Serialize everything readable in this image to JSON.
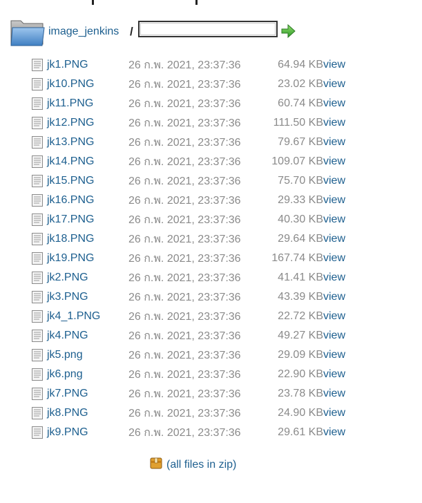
{
  "breadcrumb": {
    "directory_link": "image_jenkins",
    "separator": "/",
    "path_input_value": "",
    "go_button_icon": "go-arrow-icon"
  },
  "colors": {
    "link": "#1d5f8f",
    "muted": "#8a8a8a"
  },
  "files": [
    {
      "name": "jk1.PNG",
      "date": "26 ก.พ. 2021, 23:37:36",
      "size": "64.94 KB",
      "view": "view"
    },
    {
      "name": "jk10.PNG",
      "date": "26 ก.พ. 2021, 23:37:36",
      "size": "23.02 KB",
      "view": "view"
    },
    {
      "name": "jk11.PNG",
      "date": "26 ก.พ. 2021, 23:37:36",
      "size": "60.74 KB",
      "view": "view"
    },
    {
      "name": "jk12.PNG",
      "date": "26 ก.พ. 2021, 23:37:36",
      "size": "111.50 KB",
      "view": "view"
    },
    {
      "name": "jk13.PNG",
      "date": "26 ก.พ. 2021, 23:37:36",
      "size": "79.67 KB",
      "view": "view"
    },
    {
      "name": "jk14.PNG",
      "date": "26 ก.พ. 2021, 23:37:36",
      "size": "109.07 KB",
      "view": "view"
    },
    {
      "name": "jk15.PNG",
      "date": "26 ก.พ. 2021, 23:37:36",
      "size": "75.70 KB",
      "view": "view"
    },
    {
      "name": "jk16.PNG",
      "date": "26 ก.พ. 2021, 23:37:36",
      "size": "29.33 KB",
      "view": "view"
    },
    {
      "name": "jk17.PNG",
      "date": "26 ก.พ. 2021, 23:37:36",
      "size": "40.30 KB",
      "view": "view"
    },
    {
      "name": "jk18.PNG",
      "date": "26 ก.พ. 2021, 23:37:36",
      "size": "29.64 KB",
      "view": "view"
    },
    {
      "name": "jk19.PNG",
      "date": "26 ก.พ. 2021, 23:37:36",
      "size": "167.74 KB",
      "view": "view"
    },
    {
      "name": "jk2.PNG",
      "date": "26 ก.พ. 2021, 23:37:36",
      "size": "41.41 KB",
      "view": "view"
    },
    {
      "name": "jk3.PNG",
      "date": "26 ก.พ. 2021, 23:37:36",
      "size": "43.39 KB",
      "view": "view"
    },
    {
      "name": "jk4_1.PNG",
      "date": "26 ก.พ. 2021, 23:37:36",
      "size": "22.72 KB",
      "view": "view"
    },
    {
      "name": "jk4.PNG",
      "date": "26 ก.พ. 2021, 23:37:36",
      "size": "49.27 KB",
      "view": "view"
    },
    {
      "name": "jk5.png",
      "date": "26 ก.พ. 2021, 23:37:36",
      "size": "29.09 KB",
      "view": "view"
    },
    {
      "name": "jk6.png",
      "date": "26 ก.พ. 2021, 23:37:36",
      "size": "22.90 KB",
      "view": "view"
    },
    {
      "name": "jk7.PNG",
      "date": "26 ก.พ. 2021, 23:37:36",
      "size": "23.78 KB",
      "view": "view"
    },
    {
      "name": "jk8.PNG",
      "date": "26 ก.พ. 2021, 23:37:36",
      "size": "24.90 KB",
      "view": "view"
    },
    {
      "name": "jk9.PNG",
      "date": "26 ก.พ. 2021, 23:37:36",
      "size": "29.61 KB",
      "view": "view"
    }
  ],
  "zip": {
    "label": "(all files in zip)",
    "icon": "zip-package-icon"
  }
}
